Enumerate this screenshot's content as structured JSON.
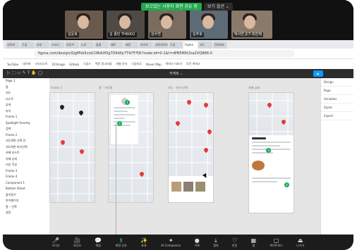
{
  "zoom": {
    "share_status": "보고있는 사용자 화면 공유 중",
    "stop_share": "보기 옵션 ⌄",
    "participants": [
      "김윤호",
      "김 종민 TH6002",
      "강수연",
      "김주호",
      "박서연 JCT·최반재"
    ],
    "toolbar": [
      "오디오",
      "비디오",
      "채팅",
      "화면 공유",
      "효과",
      "AI Companion",
      "기록",
      "캡처",
      "반응",
      "앱",
      "화이트보드",
      "나가기"
    ]
  },
  "browser": {
    "tabs": [
      "네이버",
      "구글",
      "부분",
      "스터디",
      "유튜브",
      "노션",
      "출결",
      "패토",
      "배민",
      "카카오",
      "네이버지도",
      "구글",
      "Figma",
      "지도",
      "GitHub"
    ],
    "url": "figma.com/design/iQgMVo5cioCOBdUfDg7D9d0y7T4/커넥트?node-id=0-1&t=dPB5M0t2sa2VQB66-0",
    "bookmarks": [
      "YouTube",
      "네이버",
      "스터디노트",
      "DCImage",
      "GitHub",
      "스킵스",
      "백준 알고리즘",
      "개발 문서",
      "다음지도",
      "Naver Map",
      "북마크 더보기",
      "모든 북마크"
    ]
  },
  "figma": {
    "file_title": "커넥트 ⌄",
    "play_label": "▶ Share",
    "layers": [
      "Page 1",
      "홈",
      "지도",
      "리스트",
      "상세",
      "마이",
      "Frame 1",
      "Spotlight Overlay",
      "검색",
      "Frame 2",
      "지도화면 선택 전",
      "지도화면 마커선택",
      "카페 리스트",
      "카페 상세",
      "리뷰 작성",
      "Frame 3",
      "Frame 4",
      "Component 1",
      "Bottom Sheet",
      "즐겨찾기",
      "마이페이지",
      "홈 – 선택",
      "설정"
    ],
    "frames": [
      "Frame 1",
      "홈 – 프로필",
      "지도 – 마커 선택",
      "카페 상세"
    ],
    "right_panel": [
      "Design",
      "Page",
      "Variables",
      "Styles",
      "Export"
    ]
  },
  "colors": {
    "zoom_green": "#23a94f",
    "figma_blue": "#0d99ff",
    "marker_red": "#e53935"
  }
}
